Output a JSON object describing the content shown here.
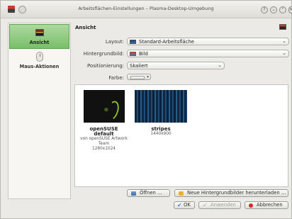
{
  "window": {
    "title": "Arbeitsflächen-Einstellungen – Plasma-Desktop-Umgebung",
    "buttons": {
      "help": "?",
      "minimize": "⌄",
      "maximize": "⌃",
      "close": "✕"
    }
  },
  "sidebar": {
    "items": [
      {
        "label": "Ansicht",
        "icon": "wallpaper-icon",
        "selected": true
      },
      {
        "label": "Maus-Aktionen",
        "icon": "mouse-icon",
        "selected": false
      }
    ]
  },
  "content": {
    "section_title": "Ansicht",
    "layout": {
      "label": "Layout:",
      "value": "Standard-Arbeitsfläche"
    },
    "background": {
      "label": "Hintergrundbild:",
      "value": "Bild"
    },
    "positioning": {
      "label": "Positionierung:",
      "value": "Skaliert"
    },
    "color": {
      "label": "Farbe:"
    }
  },
  "gallery": {
    "wallpapers": [
      {
        "title": "openSUSE default",
        "author": "von openSUSE Artwork Team",
        "size": "1280x1024"
      },
      {
        "title": "stripes",
        "size": "1440x900"
      }
    ]
  },
  "actions": {
    "open": "Öffnen ...",
    "download": "Neue Hintergrundbilder herunterladen ...",
    "ok": "OK",
    "apply": "Anwenden",
    "cancel": "Abbrechen"
  },
  "colors": {
    "selection_green": "#78bf69",
    "window_bg": "#eceae6",
    "accent_blue": "#4c7dcd",
    "cancel_red": "#d62828"
  }
}
